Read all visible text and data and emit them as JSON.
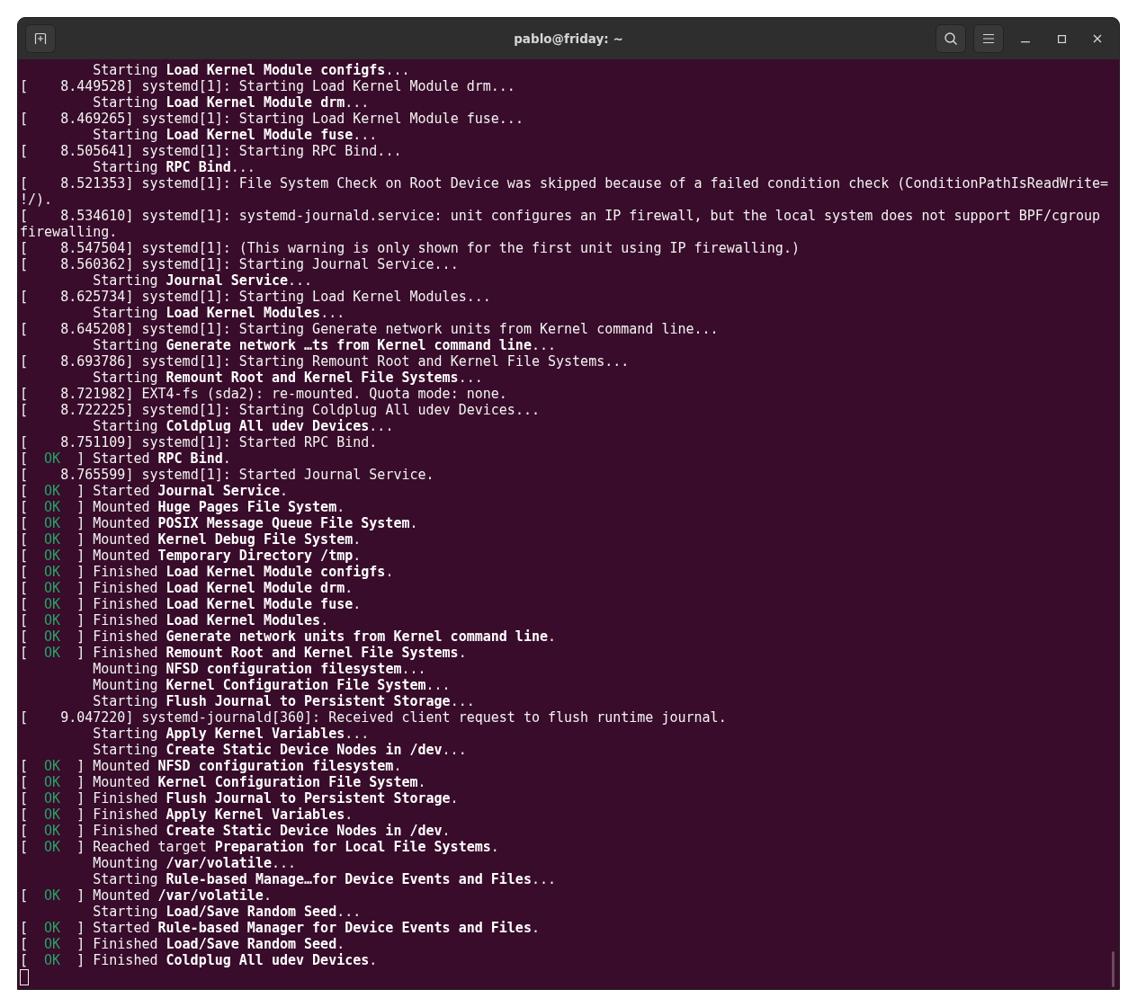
{
  "window": {
    "title": "pablo@friday: ~"
  },
  "terminal": {
    "lines": [
      {
        "kind": "job",
        "text": "Starting **Load Kernel Module configfs**..."
      },
      {
        "kind": "plain",
        "text": "[    8.449528] systemd[1]: Starting Load Kernel Module drm..."
      },
      {
        "kind": "job",
        "text": "Starting **Load Kernel Module drm**..."
      },
      {
        "kind": "plain",
        "text": "[    8.469265] systemd[1]: Starting Load Kernel Module fuse..."
      },
      {
        "kind": "job",
        "text": "Starting **Load Kernel Module fuse**..."
      },
      {
        "kind": "plain",
        "text": "[    8.505641] systemd[1]: Starting RPC Bind..."
      },
      {
        "kind": "job",
        "text": "Starting **RPC Bind**..."
      },
      {
        "kind": "plain",
        "text": "[    8.521353] systemd[1]: File System Check on Root Device was skipped because of a failed condition check (ConditionPathIsReadWrite="
      },
      {
        "kind": "plain",
        "text": "!/)."
      },
      {
        "kind": "plain",
        "text": "[    8.534610] systemd[1]: systemd-journald.service: unit configures an IP firewall, but the local system does not support BPF/cgroup"
      },
      {
        "kind": "plain",
        "text": "firewalling."
      },
      {
        "kind": "plain",
        "text": "[    8.547504] systemd[1]: (This warning is only shown for the first unit using IP firewalling.)"
      },
      {
        "kind": "plain",
        "text": "[    8.560362] systemd[1]: Starting Journal Service..."
      },
      {
        "kind": "job",
        "text": "Starting **Journal Service**..."
      },
      {
        "kind": "plain",
        "text": "[    8.625734] systemd[1]: Starting Load Kernel Modules..."
      },
      {
        "kind": "job",
        "text": "Starting **Load Kernel Modules**..."
      },
      {
        "kind": "plain",
        "text": "[    8.645208] systemd[1]: Starting Generate network units from Kernel command line..."
      },
      {
        "kind": "job",
        "text": "Starting **Generate network …ts from Kernel command line**..."
      },
      {
        "kind": "plain",
        "text": "[    8.693786] systemd[1]: Starting Remount Root and Kernel File Systems..."
      },
      {
        "kind": "job",
        "text": "Starting **Remount Root and Kernel File Systems**..."
      },
      {
        "kind": "plain",
        "text": "[    8.721982] EXT4-fs (sda2): re-mounted. Quota mode: none."
      },
      {
        "kind": "plain",
        "text": "[    8.722225] systemd[1]: Starting Coldplug All udev Devices..."
      },
      {
        "kind": "job",
        "text": "Starting **Coldplug All udev Devices**..."
      },
      {
        "kind": "plain",
        "text": "[    8.751109] systemd[1]: Started RPC Bind."
      },
      {
        "kind": "status",
        "open": "[",
        "status": "OK",
        "close": "]",
        "text": "Started **RPC Bind**."
      },
      {
        "kind": "plain",
        "text": "[    8.765599] systemd[1]: Started Journal Service."
      },
      {
        "kind": "status",
        "open": "[",
        "status": "OK",
        "close": "]",
        "text": "Started **Journal Service**."
      },
      {
        "kind": "status",
        "open": "[",
        "status": "OK",
        "close": "]",
        "text": "Mounted **Huge Pages File System**."
      },
      {
        "kind": "status",
        "open": "[",
        "status": "OK",
        "close": "]",
        "text": "Mounted **POSIX Message Queue File System**."
      },
      {
        "kind": "status",
        "open": "[",
        "status": "OK",
        "close": "]",
        "text": "Mounted **Kernel Debug File System**."
      },
      {
        "kind": "status",
        "open": "[",
        "status": "OK",
        "close": "]",
        "text": "Mounted **Temporary Directory /tmp**."
      },
      {
        "kind": "status",
        "open": "[",
        "status": "OK",
        "close": "]",
        "text": "Finished **Load Kernel Module configfs**."
      },
      {
        "kind": "status",
        "open": "[",
        "status": "OK",
        "close": "]",
        "text": "Finished **Load Kernel Module drm**."
      },
      {
        "kind": "status",
        "open": "[",
        "status": "OK",
        "close": "]",
        "text": "Finished **Load Kernel Module fuse**."
      },
      {
        "kind": "status",
        "open": "[",
        "status": "OK",
        "close": "]",
        "text": "Finished **Load Kernel Modules**."
      },
      {
        "kind": "status",
        "open": "[",
        "status": "OK",
        "close": "]",
        "text": "Finished **Generate network units from Kernel command line**."
      },
      {
        "kind": "status",
        "open": "[",
        "status": "OK",
        "close": "]",
        "text": "Finished **Remount Root and Kernel File Systems**."
      },
      {
        "kind": "job",
        "text": "Mounting **NFSD configuration filesystem**..."
      },
      {
        "kind": "job",
        "text": "Mounting **Kernel Configuration File System**..."
      },
      {
        "kind": "job",
        "text": "Starting **Flush Journal to Persistent Storage**..."
      },
      {
        "kind": "plain",
        "text": "[    9.047220] systemd-journald[360]: Received client request to flush runtime journal."
      },
      {
        "kind": "job",
        "text": "Starting **Apply Kernel Variables**..."
      },
      {
        "kind": "job",
        "text": "Starting **Create Static Device Nodes in /dev**..."
      },
      {
        "kind": "status",
        "open": "[",
        "status": "OK",
        "close": "]",
        "text": "Mounted **NFSD configuration filesystem**."
      },
      {
        "kind": "status",
        "open": "[",
        "status": "OK",
        "close": "]",
        "text": "Mounted **Kernel Configuration File System**."
      },
      {
        "kind": "status",
        "open": "[",
        "status": "OK",
        "close": "]",
        "text": "Finished **Flush Journal to Persistent Storage**."
      },
      {
        "kind": "status",
        "open": "[",
        "status": "OK",
        "close": "]",
        "text": "Finished **Apply Kernel Variables**."
      },
      {
        "kind": "status",
        "open": "[",
        "status": "OK",
        "close": "]",
        "text": "Finished **Create Static Device Nodes in /dev**."
      },
      {
        "kind": "status",
        "open": "[",
        "status": "OK",
        "close": "]",
        "text": "Reached target **Preparation for Local File Systems**."
      },
      {
        "kind": "job",
        "text": "Mounting **/var/volatile**..."
      },
      {
        "kind": "job",
        "text": "Starting **Rule-based Manage…for Device Events and Files**..."
      },
      {
        "kind": "status",
        "open": "[",
        "status": "OK",
        "close": "]",
        "text": "Mounted **/var/volatile**."
      },
      {
        "kind": "job",
        "text": "Starting **Load/Save Random Seed**..."
      },
      {
        "kind": "status",
        "open": "[",
        "status": "OK",
        "close": "]",
        "text": "Started **Rule-based Manager for Device Events and Files**."
      },
      {
        "kind": "status",
        "open": "[",
        "status": "OK",
        "close": "]",
        "text": "Finished **Load/Save Random Seed**."
      },
      {
        "kind": "status",
        "open": "[",
        "status": "OK",
        "close": "]",
        "text": "Finished **Coldplug All udev Devices**."
      }
    ]
  }
}
